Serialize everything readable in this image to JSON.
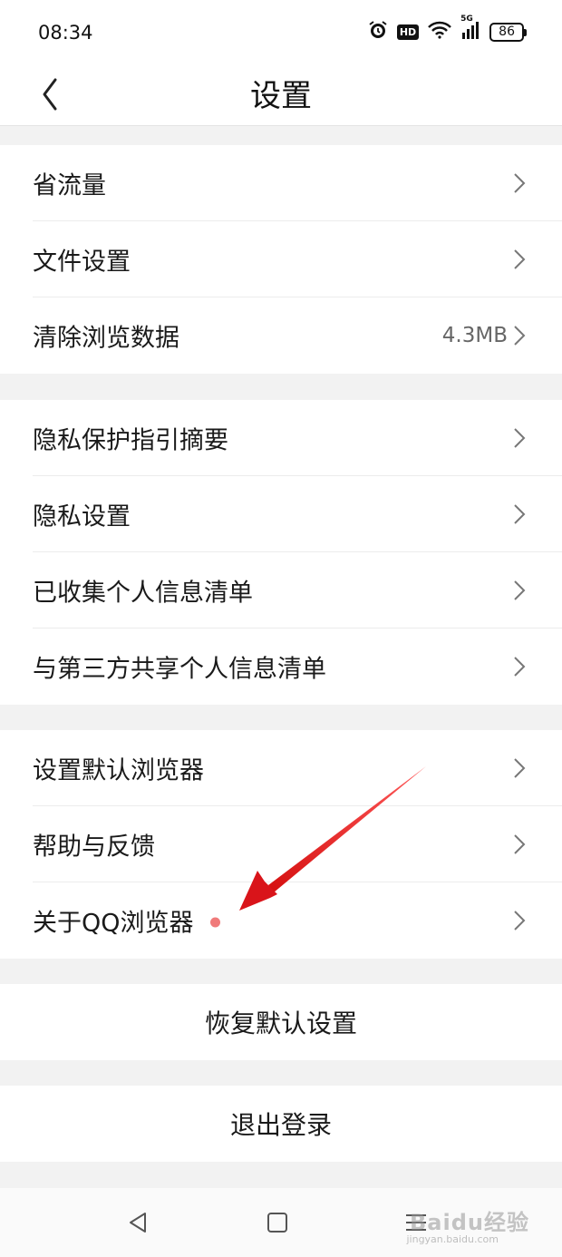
{
  "status_bar": {
    "time": "08:34",
    "hd_label": "HD",
    "signal_label": "5G",
    "battery": "86"
  },
  "header": {
    "title": "设置"
  },
  "groups": [
    {
      "items": [
        {
          "label": "省流量"
        },
        {
          "label": "文件设置"
        },
        {
          "label": "清除浏览数据",
          "value": "4.3MB"
        }
      ]
    },
    {
      "items": [
        {
          "label": "隐私保护指引摘要"
        },
        {
          "label": "隐私设置"
        },
        {
          "label": "已收集个人信息清单"
        },
        {
          "label": "与第三方共享个人信息清单"
        }
      ]
    },
    {
      "items": [
        {
          "label": "设置默认浏览器"
        },
        {
          "label": "帮助与反馈"
        },
        {
          "label": "关于QQ浏览器",
          "badge": "red-dot"
        }
      ]
    }
  ],
  "actions": {
    "restore_defaults": "恢复默认设置",
    "logout": "退出登录"
  },
  "watermark": {
    "brand": "Baidu经验",
    "url": "jingyan.baidu.com"
  },
  "colors": {
    "background": "#f2f2f2",
    "row_background": "#ffffff",
    "badge_dot": "#f07a7a",
    "annotation_arrow": "#e01a1a"
  }
}
